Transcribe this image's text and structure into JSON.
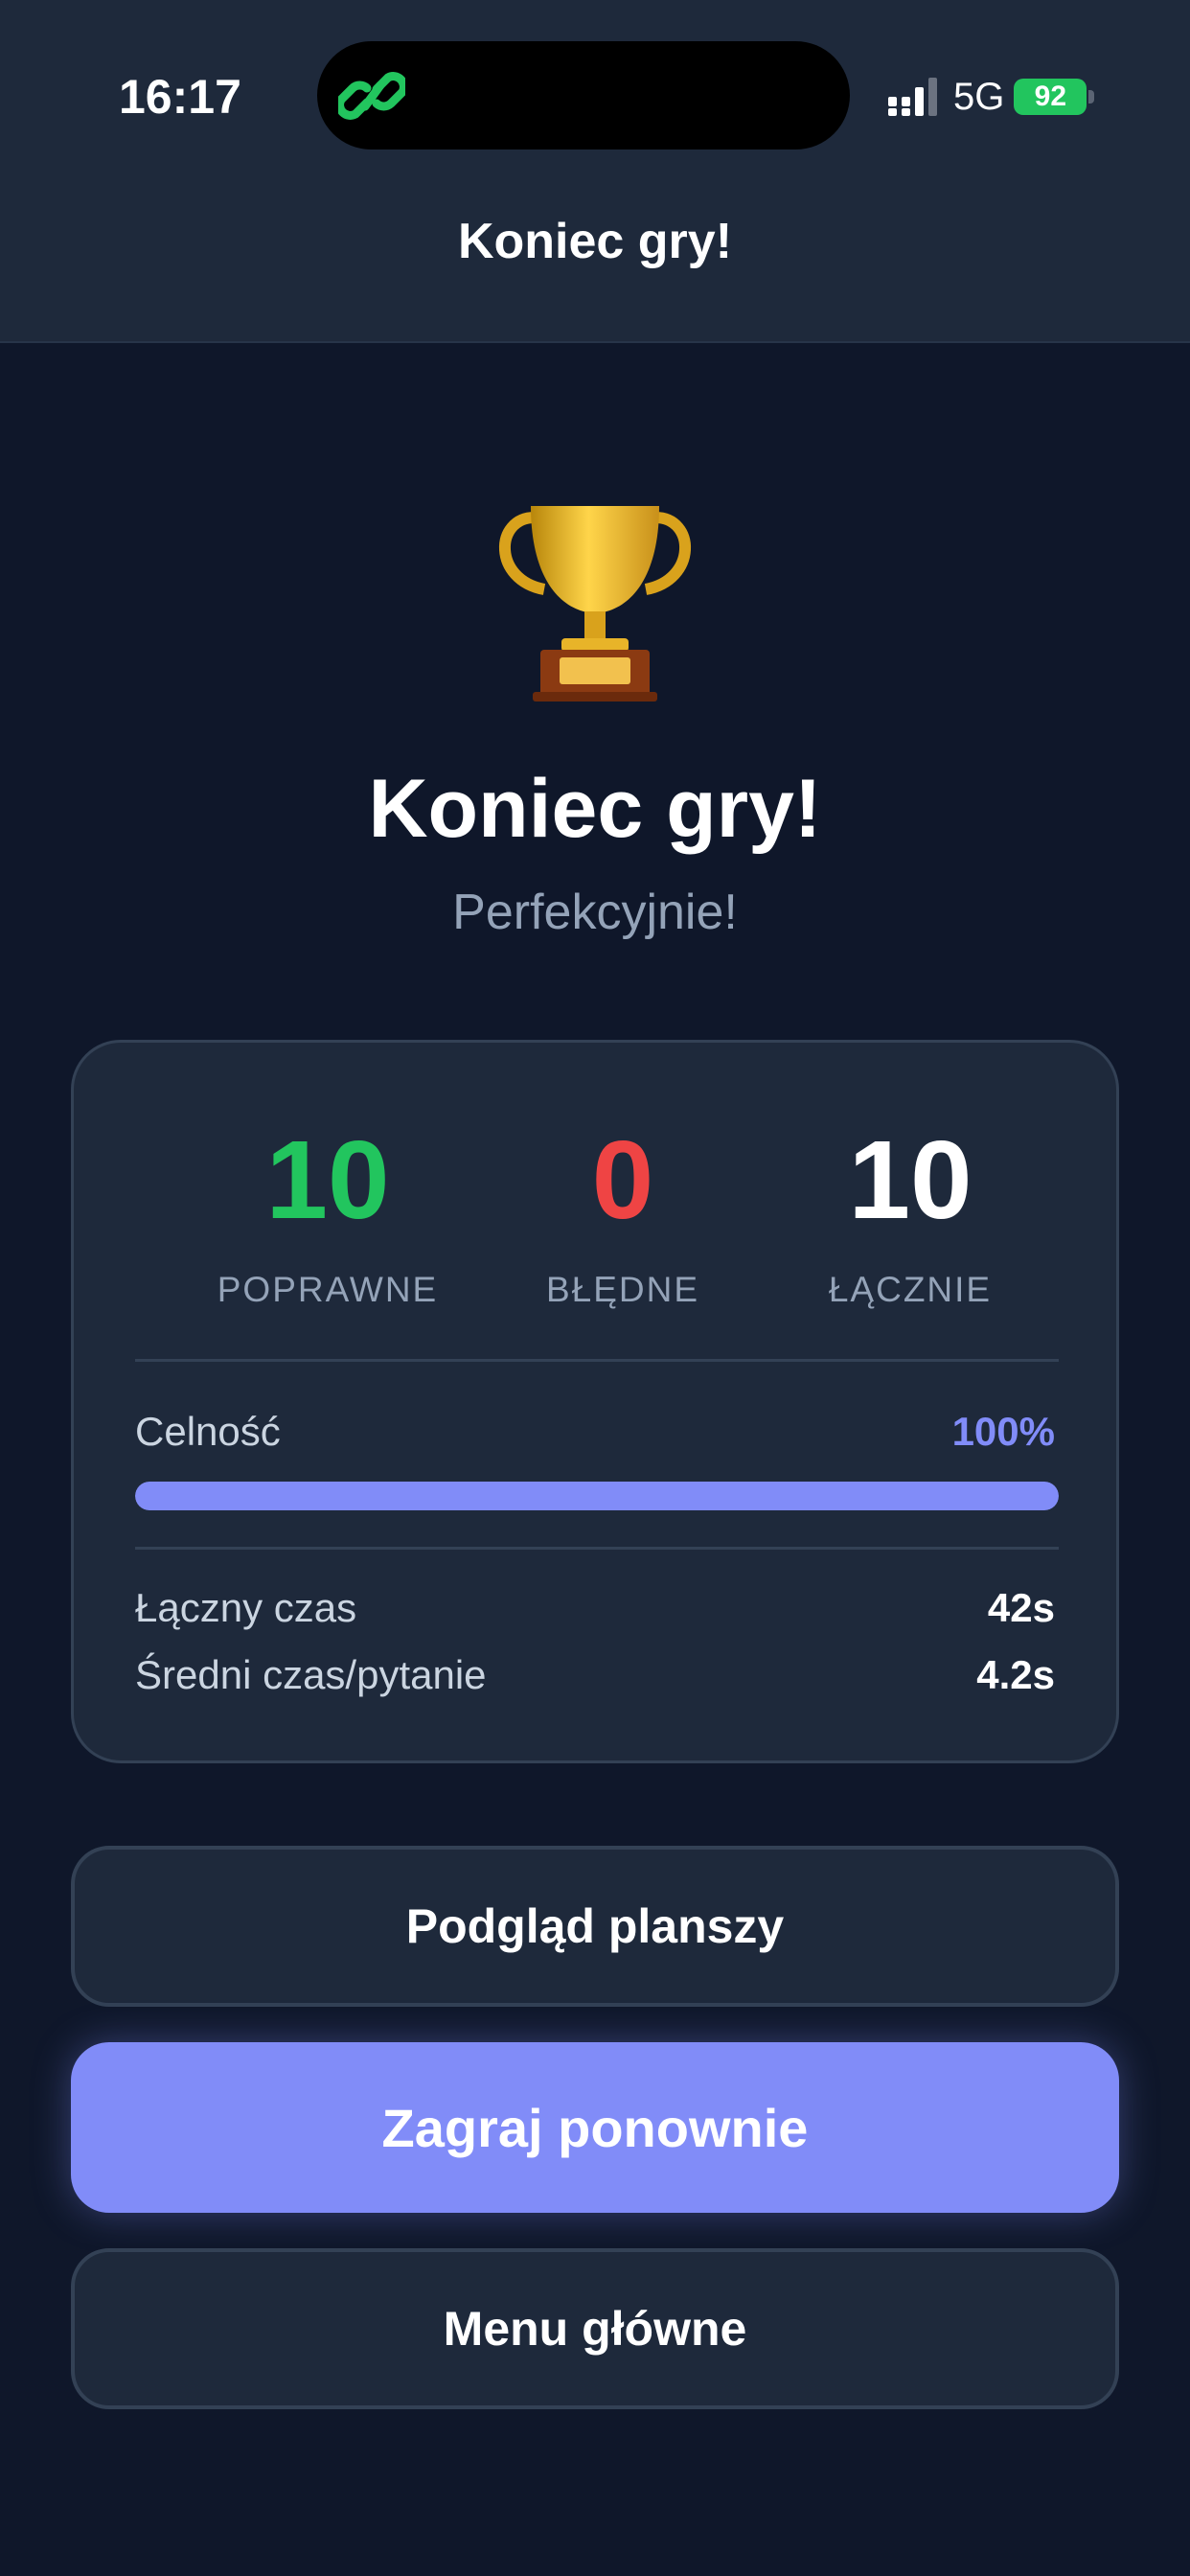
{
  "status_bar": {
    "time": "16:17",
    "network": "5G",
    "battery": "92",
    "island_app_icon": "link-icon"
  },
  "header": {
    "title": "Koniec gry!"
  },
  "hero": {
    "icon": "trophy-icon",
    "title": "Koniec gry!",
    "subtitle": "Perfekcyjnie!"
  },
  "stats": {
    "correct": {
      "value": "10",
      "label": "POPRAWNE",
      "color": "#22c55e"
    },
    "wrong": {
      "value": "0",
      "label": "BŁĘDNE",
      "color": "#ef4444"
    },
    "total": {
      "value": "10",
      "label": "ŁĄCZNIE",
      "color": "#ffffff"
    },
    "accuracy": {
      "label": "Celność",
      "value": "100%",
      "fraction": 1.0,
      "color": "#818cf8"
    },
    "total_time": {
      "label": "Łączny czas",
      "value": "42s"
    },
    "avg_time": {
      "label": "Średni czas/pytanie",
      "value": "4.2s"
    }
  },
  "buttons": {
    "preview": "Podgląd planszy",
    "play_again": "Zagraj ponownie",
    "main_menu": "Menu główne"
  },
  "colors": {
    "background": "#0f172a",
    "surface": "#1e293b",
    "accent": "#818cf8"
  }
}
